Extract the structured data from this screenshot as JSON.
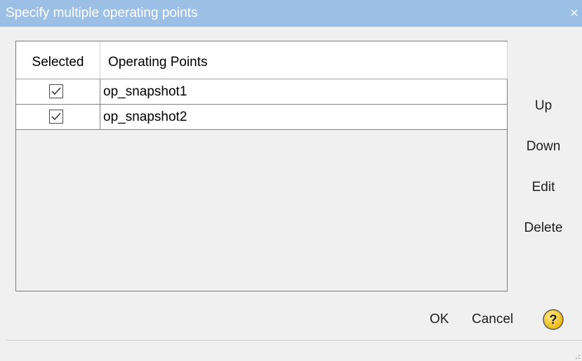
{
  "window": {
    "title": "Specify multiple operating points",
    "close_glyph": "×"
  },
  "table": {
    "columns": [
      "Selected",
      "Operating Points"
    ],
    "rows": [
      {
        "selected": true,
        "name": "op_snapshot1"
      },
      {
        "selected": true,
        "name": "op_snapshot2"
      }
    ]
  },
  "side_buttons": {
    "up": "Up",
    "down": "Down",
    "edit": "Edit",
    "delete": "Delete"
  },
  "footer": {
    "ok": "OK",
    "cancel": "Cancel",
    "help_icon": "question-circle-icon"
  },
  "colors": {
    "titlebar": "#9cbfe6",
    "background": "#f0f0f0",
    "help_icon": "#e8b400"
  }
}
